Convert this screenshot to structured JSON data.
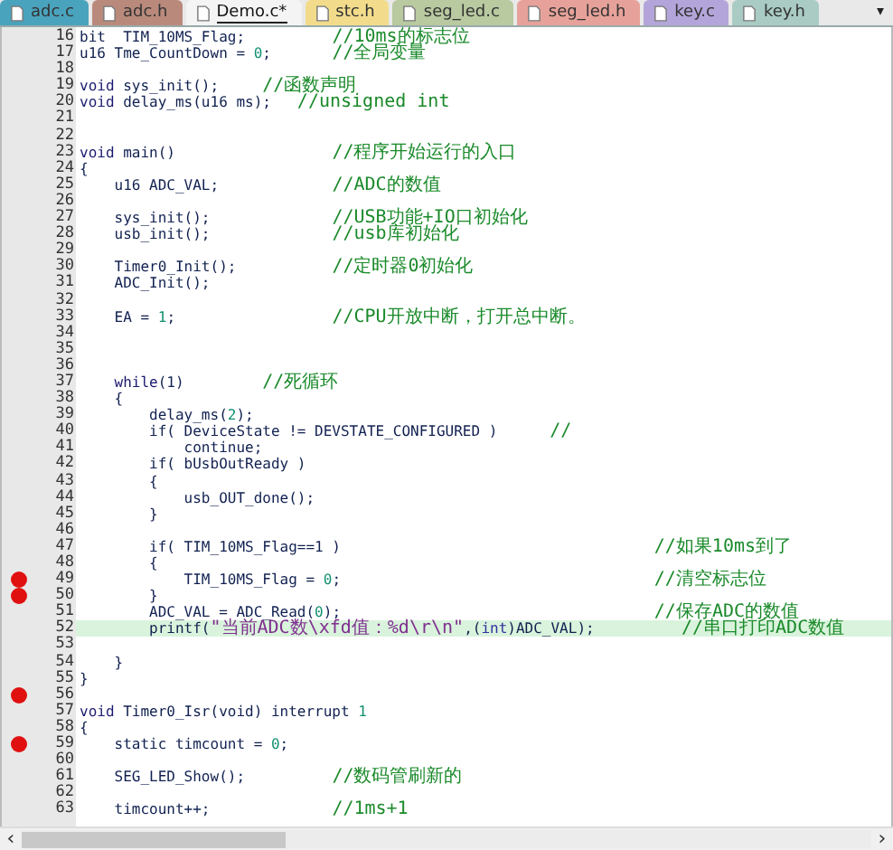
{
  "tabs": [
    {
      "label": "adc.c",
      "selected": false,
      "color": "#4aa3bd"
    },
    {
      "label": "adc.h",
      "selected": false,
      "color": "#b98a7c"
    },
    {
      "label": "Demo.c*",
      "selected": true,
      "color": "#f4f4f4"
    },
    {
      "label": "stc.h",
      "selected": false,
      "color": "#f2dc8c"
    },
    {
      "label": "seg_led.c",
      "selected": false,
      "color": "#b9c9a0"
    },
    {
      "label": "seg_led.h",
      "selected": false,
      "color": "#e6a29a"
    },
    {
      "label": "key.c",
      "selected": false,
      "color": "#b3a5d9"
    },
    {
      "label": "key.h",
      "selected": false,
      "color": "#a9cbc3"
    }
  ],
  "tab_menu": "▾",
  "lines": [
    {
      "number": "16",
      "code": [
        {
          "kind": "plain",
          "text": "bit  TIM_10MS_Flag;          "
        },
        {
          "kind": "comment",
          "text": "//10ms的标志位"
        }
      ],
      "breakpoint": false,
      "current": false
    },
    {
      "number": "17",
      "code": [
        {
          "kind": "plain",
          "text": "u16 Tme_CountDown = "
        },
        {
          "kind": "number",
          "text": "0"
        },
        {
          "kind": "plain",
          "text": ";       "
        },
        {
          "kind": "comment",
          "text": "//全局变量"
        }
      ],
      "breakpoint": false,
      "current": false
    },
    {
      "number": "18",
      "breakpoint": false,
      "current": false
    },
    {
      "number": "19",
      "code": [
        {
          "kind": "keyword",
          "text": "void"
        },
        {
          "kind": "plain",
          "text": " sys_init();     "
        },
        {
          "kind": "comment",
          "text": "//函数声明"
        }
      ],
      "breakpoint": false,
      "current": false
    },
    {
      "number": "20",
      "code": [
        {
          "kind": "keyword",
          "text": "void"
        },
        {
          "kind": "plain",
          "text": " delay_ms(u16 ms);   "
        },
        {
          "kind": "comment",
          "text": "//unsigned int"
        }
      ],
      "breakpoint": false,
      "current": false
    },
    {
      "number": "21",
      "breakpoint": false,
      "current": false
    },
    {
      "number": "22",
      "breakpoint": false,
      "current": false
    },
    {
      "number": "23",
      "code": [
        {
          "kind": "keyword",
          "text": "void"
        },
        {
          "kind": "plain",
          "text": " main()                  "
        },
        {
          "kind": "comment",
          "text": "//程序开始运行的入口"
        }
      ],
      "breakpoint": false,
      "current": false
    },
    {
      "number": "24",
      "code": [
        {
          "kind": "plain",
          "text": "{"
        }
      ],
      "breakpoint": false,
      "current": false
    },
    {
      "number": "25",
      "code": [
        {
          "kind": "plain",
          "text": "    u16 ADC_VAL;             "
        },
        {
          "kind": "comment",
          "text": "//ADC的数值"
        }
      ],
      "breakpoint": false,
      "current": false
    },
    {
      "number": "26",
      "breakpoint": false,
      "current": false
    },
    {
      "number": "27",
      "code": [
        {
          "kind": "plain",
          "text": "    sys_init();              "
        },
        {
          "kind": "comment",
          "text": "//USB功能+IO口初始化"
        }
      ],
      "breakpoint": false,
      "current": false
    },
    {
      "number": "28",
      "code": [
        {
          "kind": "plain",
          "text": "    usb_init();              "
        },
        {
          "kind": "comment",
          "text": "//usb库初始化"
        }
      ],
      "breakpoint": false,
      "current": false
    },
    {
      "number": "29",
      "breakpoint": false,
      "current": false
    },
    {
      "number": "30",
      "code": [
        {
          "kind": "plain",
          "text": "    Timer0_Init();           "
        },
        {
          "kind": "comment",
          "text": "//定时器0初始化"
        }
      ],
      "breakpoint": false,
      "current": false
    },
    {
      "number": "31",
      "code": [
        {
          "kind": "plain",
          "text": "    ADC_Init();"
        }
      ],
      "breakpoint": false,
      "current": false
    },
    {
      "number": "32",
      "breakpoint": false,
      "current": false
    },
    {
      "number": "33",
      "code": [
        {
          "kind": "plain",
          "text": "    EA = "
        },
        {
          "kind": "number",
          "text": "1"
        },
        {
          "kind": "plain",
          "text": ";                  "
        },
        {
          "kind": "comment",
          "text": "//CPU开放中断，打开总中断。"
        }
      ],
      "breakpoint": false,
      "current": false
    },
    {
      "number": "34",
      "breakpoint": false,
      "current": false
    },
    {
      "number": "35",
      "breakpoint": false,
      "current": false
    },
    {
      "number": "36",
      "breakpoint": false,
      "current": false
    },
    {
      "number": "37",
      "code": [
        {
          "kind": "keyword",
          "text": "    while"
        },
        {
          "kind": "plain",
          "text": "(1)         "
        },
        {
          "kind": "comment",
          "text": "//死循环"
        }
      ],
      "breakpoint": false,
      "current": false
    },
    {
      "number": "38",
      "code": [
        {
          "kind": "plain",
          "text": "    {"
        }
      ],
      "breakpoint": false,
      "current": false
    },
    {
      "number": "39",
      "code": [
        {
          "kind": "plain",
          "text": "        delay_ms("
        },
        {
          "kind": "number",
          "text": "2"
        },
        {
          "kind": "plain",
          "text": ");"
        }
      ],
      "breakpoint": false,
      "current": false
    },
    {
      "number": "40",
      "code": [
        {
          "kind": "plain",
          "text": "        if( DeviceState != DEVSTATE_CONFIGURED )      "
        },
        {
          "kind": "comment",
          "text": "//"
        }
      ],
      "breakpoint": false,
      "current": false
    },
    {
      "number": "41",
      "code": [
        {
          "kind": "plain",
          "text": "            continue;"
        }
      ],
      "breakpoint": false,
      "current": false
    },
    {
      "number": "42",
      "code": [
        {
          "kind": "plain",
          "text": "        if( bUsbOutReady )"
        }
      ],
      "breakpoint": false,
      "current": false
    },
    {
      "number": "43",
      "code": [
        {
          "kind": "plain",
          "text": "        {"
        }
      ],
      "breakpoint": false,
      "current": false
    },
    {
      "number": "44",
      "code": [
        {
          "kind": "plain",
          "text": "            usb_OUT_done();"
        }
      ],
      "breakpoint": false,
      "current": false
    },
    {
      "number": "45",
      "code": [
        {
          "kind": "plain",
          "text": "        }"
        }
      ],
      "breakpoint": false,
      "current": false
    },
    {
      "number": "46",
      "breakpoint": false,
      "current": false
    },
    {
      "number": "47",
      "code": [
        {
          "kind": "plain",
          "text": "        if( TIM_10MS_Flag==1 )                                    "
        },
        {
          "kind": "comment",
          "text": "//如果10ms到了"
        }
      ],
      "breakpoint": false,
      "current": false
    },
    {
      "number": "48",
      "code": [
        {
          "kind": "plain",
          "text": "        {"
        }
      ],
      "breakpoint": false,
      "current": false
    },
    {
      "number": "49",
      "code": [
        {
          "kind": "plain",
          "text": "            TIM_10MS_Flag = "
        },
        {
          "kind": "number",
          "text": "0"
        },
        {
          "kind": "plain",
          "text": ";                                    "
        },
        {
          "kind": "comment",
          "text": "//清空标志位"
        }
      ],
      "breakpoint": true,
      "current": false
    },
    {
      "number": "50",
      "code": [
        {
          "kind": "plain",
          "text": "        }"
        }
      ],
      "breakpoint": true,
      "current": false
    },
    {
      "number": "51",
      "code": [
        {
          "kind": "plain",
          "text": "        ADC_VAL = ADC_Read("
        },
        {
          "kind": "number",
          "text": "0"
        },
        {
          "kind": "plain",
          "text": ");                                    "
        },
        {
          "kind": "comment",
          "text": "//保存ADC的数值"
        }
      ],
      "breakpoint": false,
      "current": false
    },
    {
      "number": "52",
      "code": [
        {
          "kind": "plain",
          "text": "        printf("
        },
        {
          "kind": "string",
          "text": "\"当前ADC数\\xfd值：%d\\r\\n\""
        },
        {
          "kind": "plain",
          "text": ",("
        },
        {
          "kind": "type",
          "text": "int"
        },
        {
          "kind": "plain",
          "text": ")ADC_VAL);          "
        },
        {
          "kind": "comment",
          "text": "//串口打印ADC数值"
        }
      ],
      "breakpoint": false,
      "current": true
    },
    {
      "number": "53",
      "breakpoint": false,
      "current": false
    },
    {
      "number": "54",
      "code": [
        {
          "kind": "plain",
          "text": "    }"
        }
      ],
      "breakpoint": false,
      "current": false
    },
    {
      "number": "55",
      "code": [
        {
          "kind": "plain",
          "text": "}"
        }
      ],
      "breakpoint": false,
      "current": false
    },
    {
      "number": "56",
      "breakpoint": true,
      "current": false
    },
    {
      "number": "57",
      "code": [
        {
          "kind": "keyword",
          "text": "void"
        },
        {
          "kind": "plain",
          "text": " Timer0_Isr(void) interrupt "
        },
        {
          "kind": "number",
          "text": "1"
        }
      ],
      "breakpoint": false,
      "current": false
    },
    {
      "number": "58",
      "code": [
        {
          "kind": "plain",
          "text": "{"
        }
      ],
      "breakpoint": false,
      "current": false
    },
    {
      "number": "59",
      "code": [
        {
          "kind": "plain",
          "text": "    static timcount = "
        },
        {
          "kind": "number",
          "text": "0"
        },
        {
          "kind": "plain",
          "text": ";"
        }
      ],
      "breakpoint": true,
      "current": false
    },
    {
      "number": "60",
      "breakpoint": false,
      "current": false
    },
    {
      "number": "61",
      "code": [
        {
          "kind": "plain",
          "text": "    SEG_LED_Show();          "
        },
        {
          "kind": "comment",
          "text": "//数码管刷新的"
        }
      ],
      "breakpoint": false,
      "current": false
    },
    {
      "number": "62",
      "breakpoint": false,
      "current": false
    },
    {
      "number": "63",
      "code": [
        {
          "kind": "plain",
          "text": "    timcount++;              "
        },
        {
          "kind": "comment",
          "text": "//1ms+1"
        }
      ],
      "breakpoint": false,
      "current": false
    }
  ],
  "scrollbar": {
    "left": "‹",
    "right": "›"
  }
}
